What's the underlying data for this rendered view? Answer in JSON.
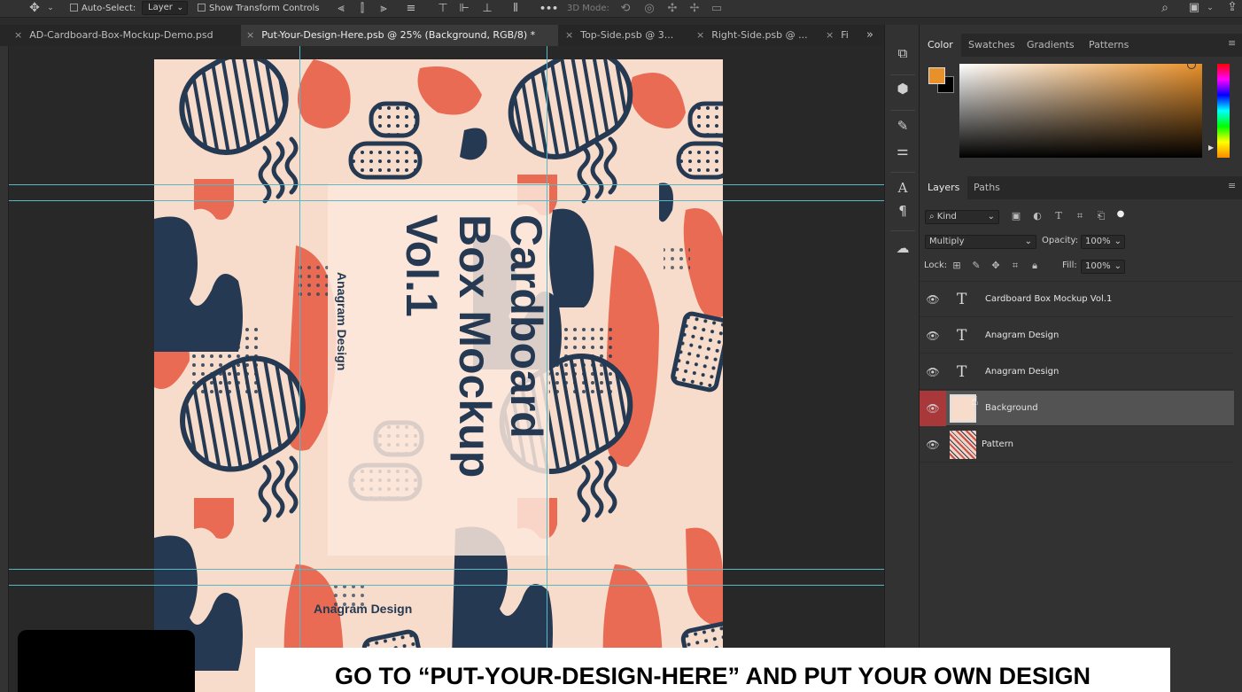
{
  "options_bar": {
    "auto_select_label": "Auto-Select:",
    "auto_select_target": "Layer",
    "show_transform_label": "Show Transform Controls",
    "three_d_mode_label": "3D Mode:",
    "more_label": "•••"
  },
  "document_tabs": [
    {
      "label": "AD-Cardboard-Box-Mockup-Demo.psd"
    },
    {
      "label": "Put-Your-Design-Here.psb @ 25% (Background, RGB/8) *"
    },
    {
      "label": "Top-Side.psb @ 3..."
    },
    {
      "label": "Right-Side.psb @ ..."
    },
    {
      "label": "Fi"
    }
  ],
  "tab_overflow": "»",
  "artwork": {
    "title_line1": "Cardboard",
    "title_line2": "Box Mockup",
    "title_line3": "Vol.1",
    "side_label": "Anagram Design",
    "bottom_label": "Anagram Design"
  },
  "color_panel": {
    "tabs": [
      "Color",
      "Swatches",
      "Gradients",
      "Patterns"
    ],
    "foreground": "#e8902a",
    "background": "#000000"
  },
  "layers_panel": {
    "tabs": [
      "Layers",
      "Paths"
    ],
    "filter_kind": "Kind",
    "blend_mode": "Multiply",
    "opacity_label": "Opacity:",
    "opacity_value": "100%",
    "lock_label": "Lock:",
    "fill_label": "Fill:",
    "fill_value": "100%",
    "layers": [
      {
        "name": "Cardboard  Box Mockup  Vol.1",
        "type": "text"
      },
      {
        "name": "Anagram Design",
        "type": "text"
      },
      {
        "name": "Anagram Design",
        "type": "text"
      },
      {
        "name": "Background",
        "type": "pixel",
        "selected": true
      },
      {
        "name": "Pattern",
        "type": "pixel"
      }
    ]
  },
  "caption": "GO TO “PUT-YOUR-DESIGN-HERE” AND PUT YOUR OWN DESIGN",
  "colors": {
    "accent_red": "#a8383a",
    "artwork_bg": "#f7dccb",
    "navy": "#253a52",
    "coral": "#ea6b53",
    "guide": "#58b9c4"
  }
}
